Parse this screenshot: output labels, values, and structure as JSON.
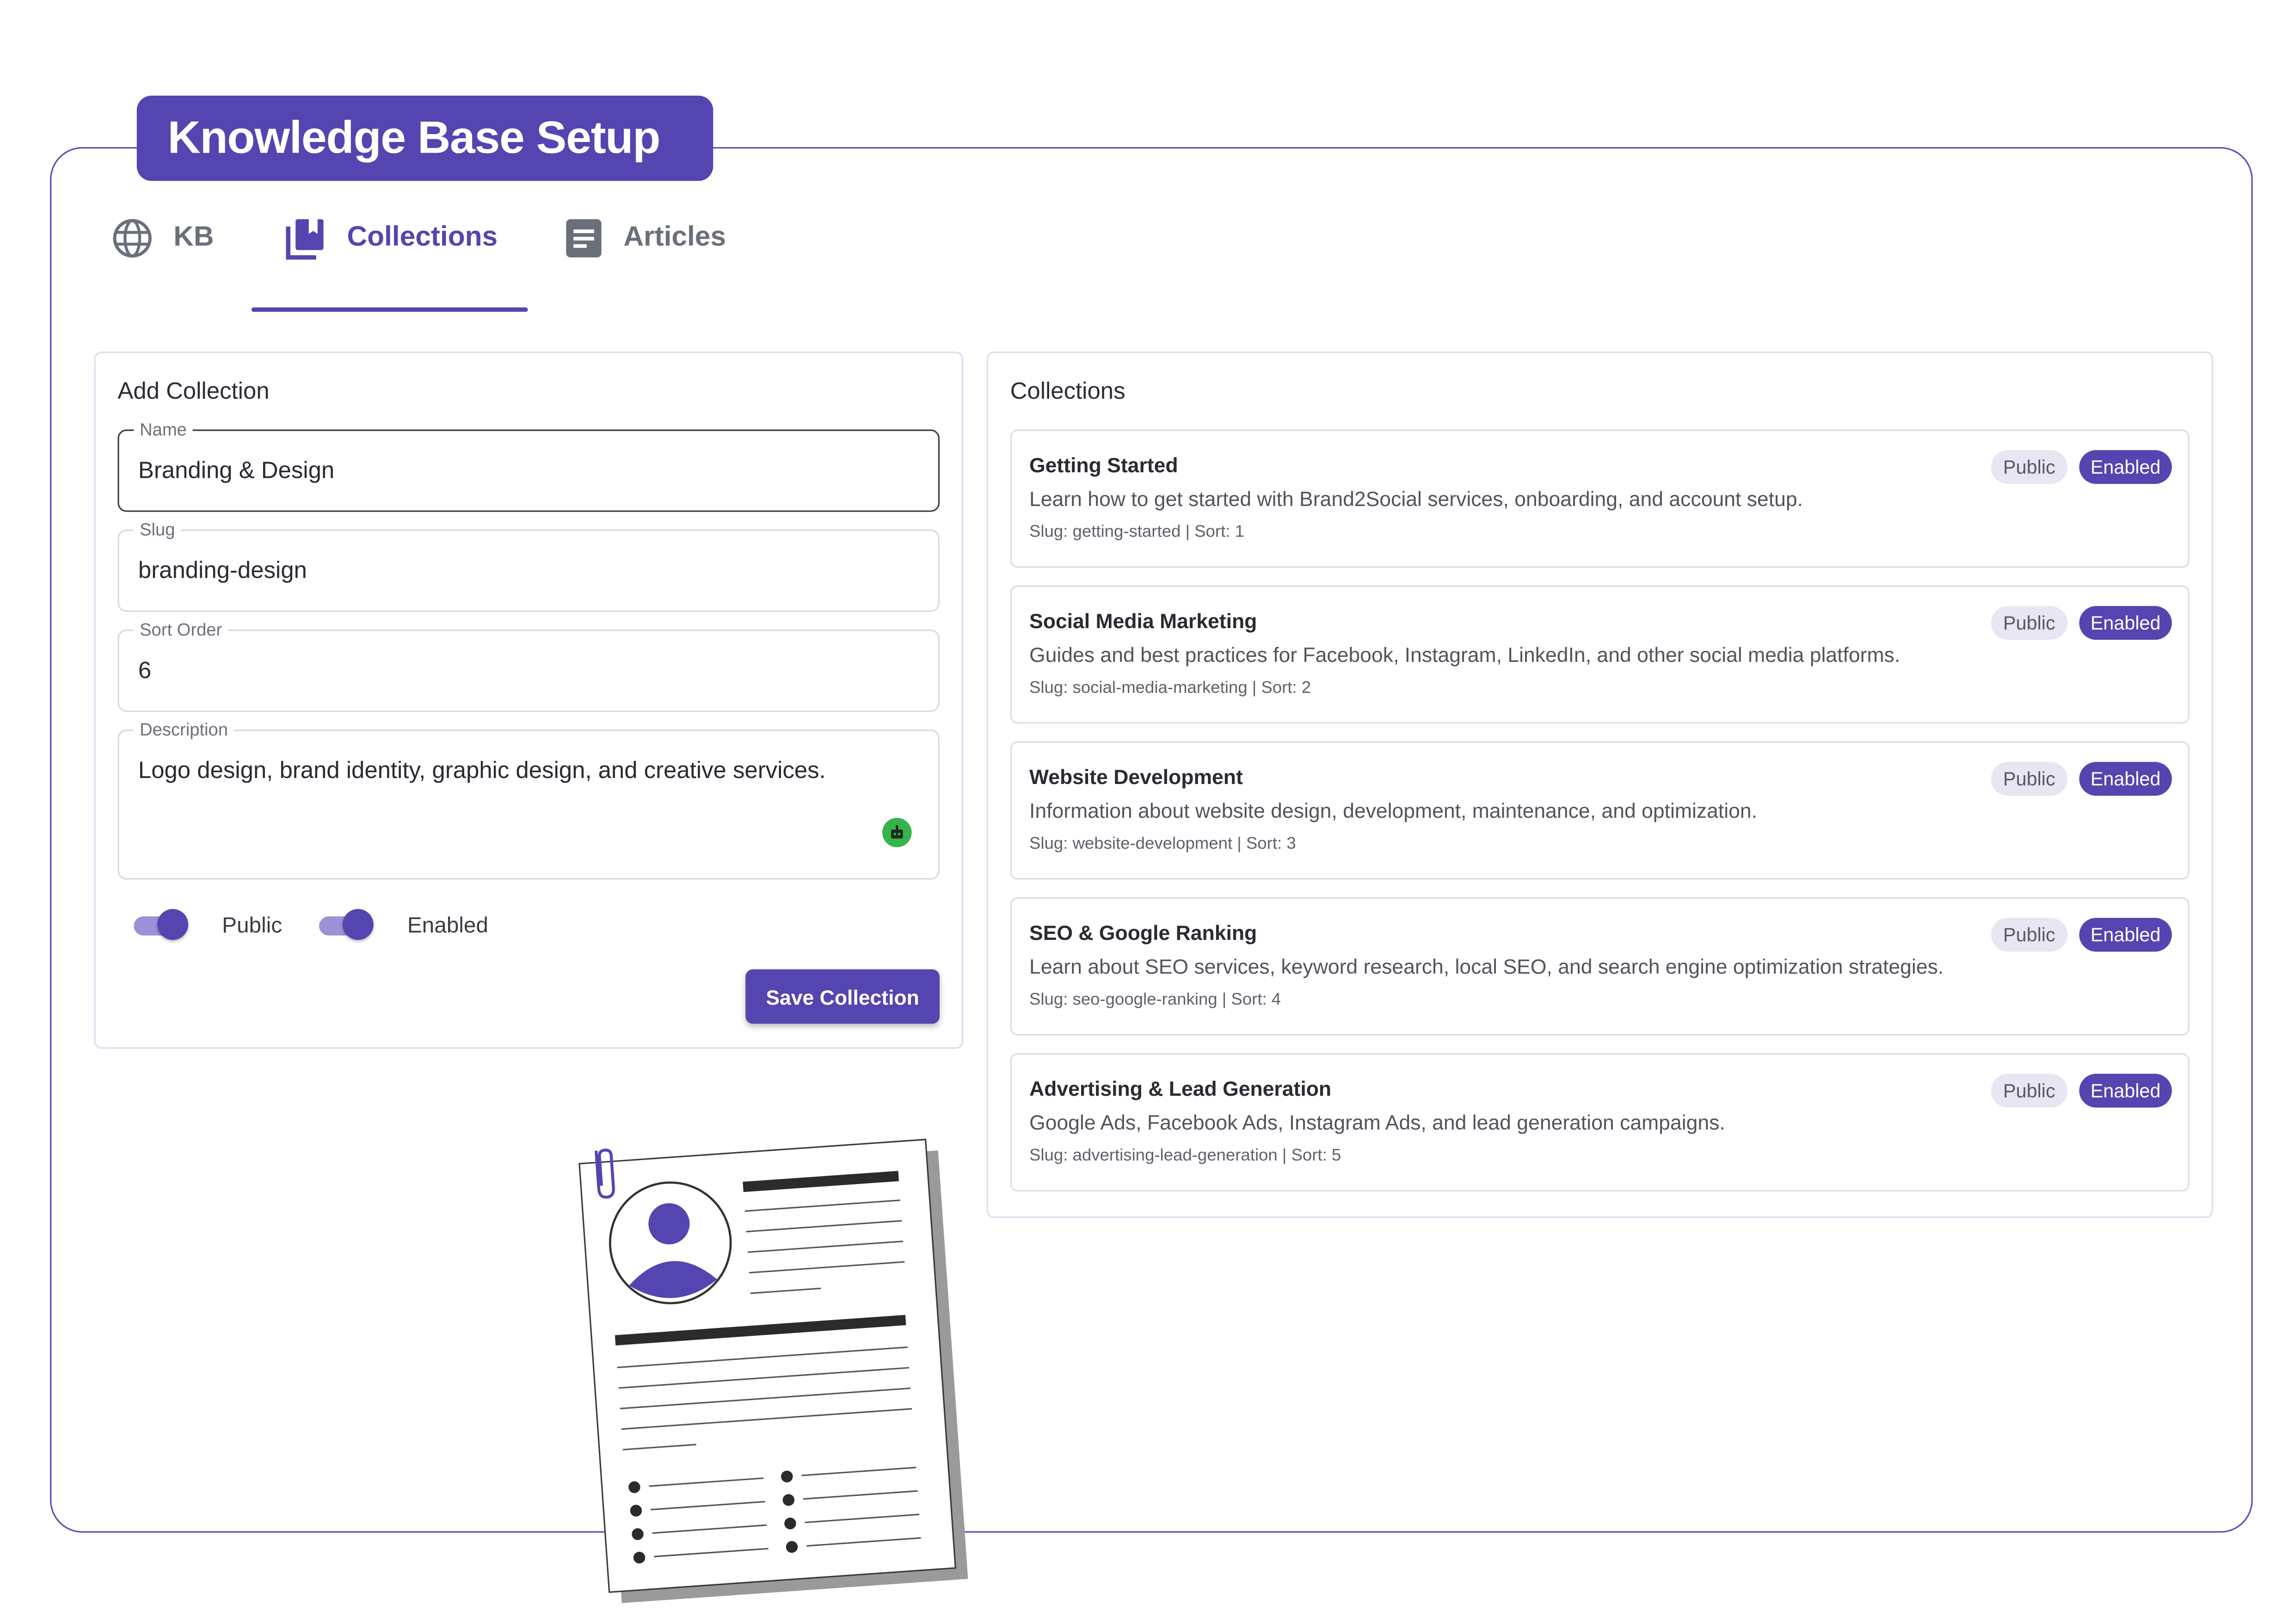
{
  "app": {
    "title": "Knowledge Base Setup"
  },
  "tabs": [
    {
      "label": "KB",
      "icon": "globe-icon",
      "active": false
    },
    {
      "label": "Collections",
      "icon": "library-books-icon",
      "active": true
    },
    {
      "label": "Articles",
      "icon": "article-icon",
      "active": false
    }
  ],
  "form": {
    "title": "Add Collection",
    "name": {
      "label": "Name",
      "value": "Branding & Design"
    },
    "slug": {
      "label": "Slug",
      "value": "branding-design"
    },
    "sort_order": {
      "label": "Sort Order",
      "value": "6"
    },
    "description": {
      "label": "Description",
      "value": "Logo design, brand identity, graphic design, and creative services."
    },
    "public_toggle": {
      "label": "Public",
      "on": true
    },
    "enabled_toggle": {
      "label": "Enabled",
      "on": true
    },
    "save_label": "Save Collection"
  },
  "collections": {
    "title": "Collections",
    "items": [
      {
        "title": "Getting Started",
        "description": "Learn how to get started with Brand2Social services, onboarding, and account setup.",
        "meta": "Slug: getting-started | Sort: 1",
        "public_label": "Public",
        "enabled_label": "Enabled"
      },
      {
        "title": "Social Media Marketing",
        "description": "Guides and best practices for Facebook, Instagram, LinkedIn, and other social media platforms.",
        "meta": "Slug: social-media-marketing | Sort: 2",
        "public_label": "Public",
        "enabled_label": "Enabled"
      },
      {
        "title": "Website Development",
        "description": "Information about website design, development, maintenance, and optimization.",
        "meta": "Slug: website-development | Sort: 3",
        "public_label": "Public",
        "enabled_label": "Enabled"
      },
      {
        "title": "SEO & Google Ranking",
        "description": "Learn about SEO services, keyword research, local SEO, and search engine optimization strategies.",
        "meta": "Slug: seo-google-ranking | Sort: 4",
        "public_label": "Public",
        "enabled_label": "Enabled"
      },
      {
        "title": "Advertising & Lead Generation",
        "description": "Google Ads, Facebook Ads, Instagram Ads, and lead generation campaigns.",
        "meta": "Slug: advertising-lead-generation | Sort: 5",
        "public_label": "Public",
        "enabled_label": "Enabled"
      }
    ]
  },
  "colors": {
    "accent": "#5445b0",
    "toggle_track": "#9b92d6",
    "ai_badge": "#36b34a"
  }
}
